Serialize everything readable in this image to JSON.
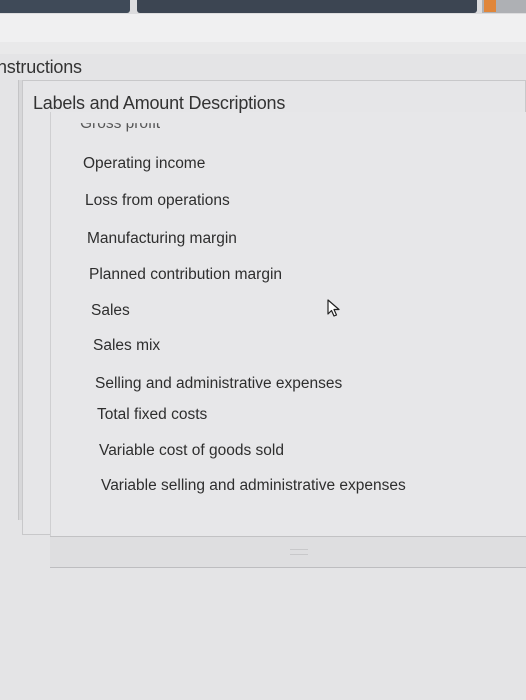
{
  "instructions_title": "nstructions",
  "panel_title": "Labels and Amount Descriptions",
  "items": [
    "Gross profit",
    "Operating income",
    "Loss from operations",
    "Manufacturing margin",
    "Planned contribution margin",
    "Sales",
    "Sales mix",
    "Selling and administrative expenses",
    "Total fixed costs",
    "Variable cost of goods sold",
    "Variable selling and administrative expenses"
  ],
  "icons": {
    "cursor": "mouse-pointer-icon"
  }
}
